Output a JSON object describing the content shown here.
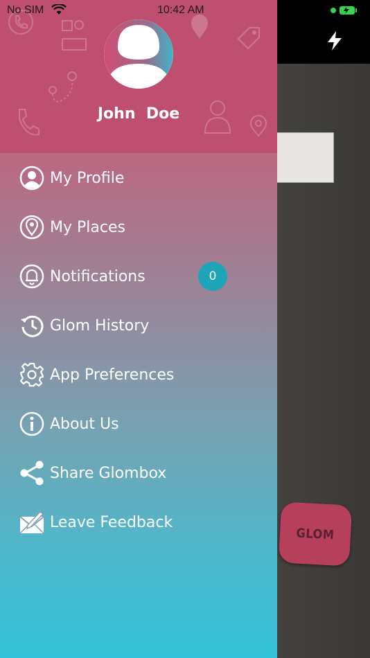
{
  "status_bar": {
    "carrier": "No SIM",
    "time": "10:42 AM"
  },
  "drawer": {
    "user_name": "John  Doe",
    "menu": [
      {
        "label": "My Profile",
        "icon": "user-circle-icon"
      },
      {
        "label": "My Places",
        "icon": "location-pin-icon"
      },
      {
        "label": "Notifications",
        "icon": "bell-icon",
        "badge": "0"
      },
      {
        "label": "Glom History",
        "icon": "history-icon"
      },
      {
        "label": "App Preferences",
        "icon": "gear-icon"
      },
      {
        "label": "About Us",
        "icon": "info-icon"
      },
      {
        "label": "Share Glombox",
        "icon": "share-icon"
      },
      {
        "label": "Leave Feedback",
        "icon": "feedback-envelope-icon"
      }
    ]
  },
  "background_app": {
    "glom_button_label": "GLOM"
  },
  "colors": {
    "header": "#bf4f70",
    "gradient_top": "#c85371",
    "gradient_bottom": "#33c4da",
    "badge": "#1ea6b8"
  }
}
